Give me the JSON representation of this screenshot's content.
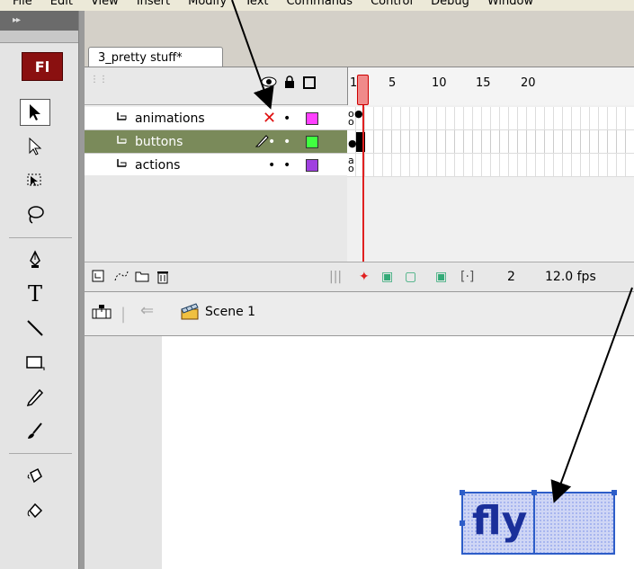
{
  "menu": [
    "File",
    "Edit",
    "View",
    "Insert",
    "Modify",
    "Text",
    "Commands",
    "Control",
    "Debug",
    "Window"
  ],
  "tools_panel": {
    "collapse_glyph": "▸▸",
    "logo": "Fl"
  },
  "document_tab": {
    "label": "3_pretty stuff*"
  },
  "timeline": {
    "frame_numbers": [
      "1",
      "5",
      "10",
      "15",
      "20"
    ],
    "layers": [
      {
        "name": "animations",
        "hidden_marker": "✕",
        "lock": "•",
        "outline_color": "#ff40ff"
      },
      {
        "name": "buttons",
        "hidden_marker": "•",
        "lock": "•",
        "outline_color": "#40ff40"
      },
      {
        "name": "actions",
        "hidden_marker": "•",
        "lock": "•",
        "outline_color": "#a040e0"
      }
    ],
    "footer": {
      "current_frame": "2",
      "frame_rate": "12.0 fps"
    }
  },
  "edit_bar": {
    "scene_label": "Scene 1"
  },
  "stage": {
    "button_text": "fly",
    "button_fill": "#cfd6f5",
    "selection_color": "#2d5dc8"
  }
}
